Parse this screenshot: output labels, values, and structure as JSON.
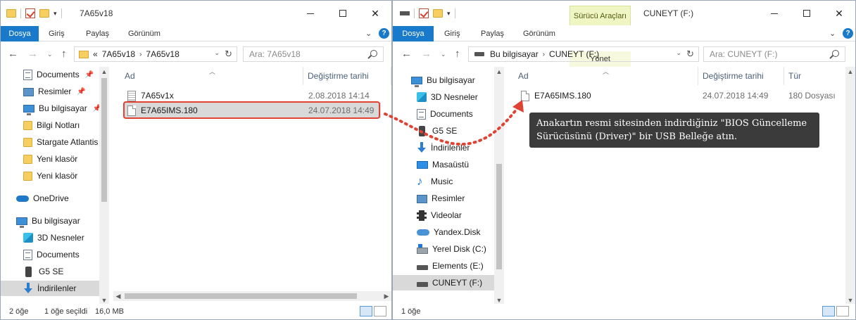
{
  "left": {
    "title": "7A65v18",
    "ribbon": {
      "file": "Dosya",
      "home": "Giriş",
      "share": "Paylaş",
      "view": "Görünüm"
    },
    "address": {
      "prefix": "«",
      "parts": [
        "7A65v18",
        "7A65v18"
      ]
    },
    "search_placeholder": "Ara: 7A65v18",
    "nav": [
      {
        "label": "Documents",
        "icon": "documents-icon",
        "pinned": true
      },
      {
        "label": "Resimler",
        "icon": "pictures-icon",
        "pinned": true
      },
      {
        "label": "Bu bilgisayar",
        "icon": "computer-icon",
        "pinned": true
      },
      {
        "label": "Bilgi Notları",
        "icon": "folder-icon"
      },
      {
        "label": "Stargate Atlantis",
        "icon": "folder-icon"
      },
      {
        "label": "Yeni klasör",
        "icon": "folder-icon"
      },
      {
        "label": "Yeni klasör",
        "icon": "folder-icon"
      },
      {
        "label": "OneDrive",
        "icon": "onedrive-icon"
      },
      {
        "label": "Bu bilgisayar",
        "icon": "computer-icon"
      },
      {
        "label": "3D Nesneler",
        "icon": "3d-objects-icon"
      },
      {
        "label": "Documents",
        "icon": "documents-icon"
      },
      {
        "label": "G5 SE",
        "icon": "phone-icon"
      },
      {
        "label": "İndirilenler",
        "icon": "downloads-icon"
      }
    ],
    "columns": {
      "name": "Ad",
      "date": "Değiştirme tarihi"
    },
    "files": [
      {
        "name": "7A65v1x",
        "date": "2.08.2018 14:14"
      },
      {
        "name": "E7A65IMS.180",
        "date": "24.07.2018 14:49"
      }
    ],
    "status": {
      "count": "2 öğe",
      "selected": "1 öğe seçildi",
      "size": "16,0 MB"
    }
  },
  "right": {
    "title": "CUNEYT (F:)",
    "context_tab": "Sürücü Araçları",
    "context_sub": "Yönet",
    "ribbon": {
      "file": "Dosya",
      "home": "Giriş",
      "share": "Paylaş",
      "view": "Görünüm"
    },
    "address": {
      "parts": [
        "Bu bilgisayar",
        "CUNEYT (F:)"
      ]
    },
    "search_placeholder": "Ara: CUNEYT (F:)",
    "nav": [
      {
        "label": "Bu bilgisayar",
        "icon": "computer-icon"
      },
      {
        "label": "3D Nesneler",
        "icon": "3d-objects-icon"
      },
      {
        "label": "Documents",
        "icon": "documents-icon"
      },
      {
        "label": "G5 SE",
        "icon": "phone-icon"
      },
      {
        "label": "İndirilenler",
        "icon": "downloads-icon"
      },
      {
        "label": "Masaüstü",
        "icon": "desktop-icon"
      },
      {
        "label": "Music",
        "icon": "music-icon"
      },
      {
        "label": "Resimler",
        "icon": "pictures-icon"
      },
      {
        "label": "Videolar",
        "icon": "videos-icon"
      },
      {
        "label": "Yandex.Disk",
        "icon": "yandex-disk-icon"
      },
      {
        "label": "Yerel Disk (C:)",
        "icon": "local-disk-icon"
      },
      {
        "label": "Elements (E:)",
        "icon": "drive-icon"
      },
      {
        "label": "CUNEYT (F:)",
        "icon": "usb-drive-icon",
        "selected": true
      }
    ],
    "columns": {
      "name": "Ad",
      "date": "Değiştirme tarihi",
      "type": "Tür"
    },
    "files": [
      {
        "name": "E7A65IMS.180",
        "date": "24.07.2018 14:49",
        "type": "180 Dosyası"
      }
    ],
    "status": {
      "count": "1 öğe"
    }
  },
  "tooltip": "Anakartın resmi sitesinden indirdiğiniz \"BIOS Güncelleme Sürücüsünü (Driver)\" bir USB Belleğe atın.",
  "colors": {
    "highlight": "#e04233",
    "accent": "#1979ca",
    "tooltip_bg": "#3b3b3b"
  }
}
